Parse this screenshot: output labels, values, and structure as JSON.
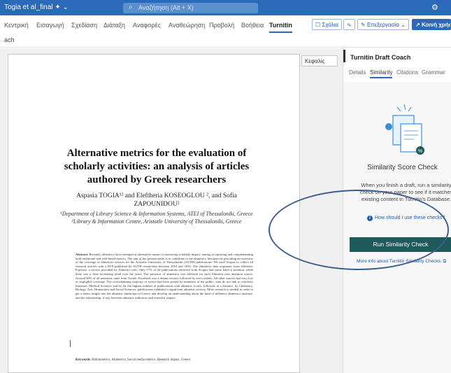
{
  "titlebar": {
    "doc_name": "Togia et al_final",
    "doc_suffix": "✦ ⌄",
    "search_placeholder": "Αναζήτηση (Alt + X)"
  },
  "ribbon": {
    "tabs": [
      "Κεντρική",
      "Εισαγωγή",
      "Σχεδίαση",
      "Διάταξη",
      "Αναφορές",
      "Αναθεώρηση",
      "Προβολή",
      "Βοήθεια",
      "Turnitin"
    ],
    "comments_label": "Σχόλια",
    "editing_label": "Επεξεργασία ⌄",
    "share_label": "Κοινή χρήση"
  },
  "subbar": {
    "label": "ach"
  },
  "tooltip": {
    "text": "Κεφαλίς"
  },
  "document": {
    "title": "Alternative metrics for the evaluation of scholarly activities: an analysis of articles authored by Greek researchers",
    "authors_line1": "Aspasia TOGIA¹² and Eleftheria KOSEOGLOU ², and Sofia",
    "authors_line2": "ZAPOUNIDOU²",
    "affiliation1": "¹Department of Library Science & Information Systems, ATEI of Thessaloniki, Greece",
    "affiliation2": "²Library & Information Centre, Aristotle University of Thessaloniki, Greece",
    "abstract_lead": "Abstract.",
    "abstract_text": "Recently, altmetrics have emerged as alternative means of measuring scholarly impact, aiming at capturing and complementing both traditional and web-based metrics. The aim of the present study is to contribute to the altmetrics literature by providing an overview of the coverage of altmetrics sources for the Aristotle University of Thessaloniki (AUTH) publications. We used Scopus to collect all research articles with a DOI published by AUTH researchers between 2010 and 2016. The altmetrics data originates from Altmetric Explorer, a service provided by Altmetric.com. Only 17% of all publications retrieved from Scopus had some kind of mention, while there was a clear increasing trend over the years. The presence of altmetrics was different for each Altmetric.com attention source. Around 80% of all mentions came from Twitter. Facebook was a distant second, followed by news outlets. All other sources had very low or negligible coverage. The overwhelming majority of tweets had been posted by members of the public, who do not link to scholarly literature. Medical Sciences and by far the highest number of publications with altmetric scores, followed, at a distance, by Chemistry, Biology, Arts, Humanities and Social Sciences; publications exhibited a significant altmetric activity. More research is needed in order to get a better insight into the altmetric landscape in Greece and develop an understanding about the kind of influence altmetrics measure, and the relationship, if any, between altmetric indicators and scientific impact.",
    "keywords_lead": "Keywords.",
    "keywords_text": "Bibliometrics, Altmetrics, Social media metrics, Research impact, Greece"
  },
  "panel": {
    "title": "Turnitin Draft Coach",
    "tabs": [
      "Details",
      "Similarity",
      "Citations",
      "Grammar"
    ],
    "heading": "Similarity Score Check",
    "description": "When you finish a draft, run a similarity check on your paper to see if it matches existing content in Turnitin's Database.",
    "help_link": "How should I use these checks?",
    "run_button": "Run Similarity Check",
    "more_info": "More info about Turnitin Similarity Checks. ⧉"
  }
}
